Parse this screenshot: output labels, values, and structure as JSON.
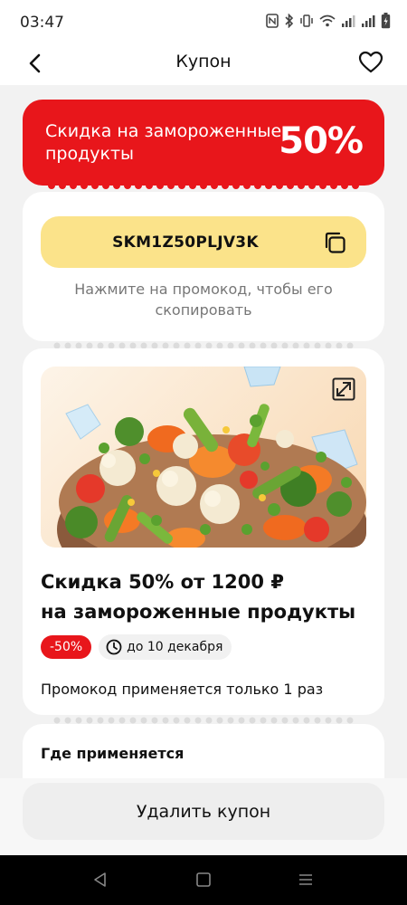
{
  "status_bar": {
    "time": "03:47",
    "icons": [
      "nfc-icon",
      "bluetooth-icon",
      "vibrate-icon",
      "wifi-icon",
      "signal-icon",
      "signal-icon",
      "battery-charging-icon"
    ]
  },
  "header": {
    "title": "Купон",
    "back_icon": "chevron-left-icon",
    "favorite_icon": "heart-outline-icon"
  },
  "banner": {
    "text": "Скидка на замороженные продукты",
    "percent": "50%",
    "color": "#e8161b"
  },
  "promo": {
    "code": "SKM1Z50PLJV3K",
    "copy_icon": "copy-icon",
    "hint": "Нажмите на промокод, чтобы его скопировать",
    "code_bg": "#fbe38a"
  },
  "offer": {
    "image_alt_icon": "expand-icon",
    "title_line1": "Скидка 50% от 1200 ₽",
    "title_line2": "на замороженные продукты",
    "discount_badge": "-50%",
    "date_badge": "до 10 декабря",
    "note": "Промокод применяется только 1 раз"
  },
  "where": {
    "title": "Где применяется"
  },
  "actions": {
    "delete_label": "Удалить купон"
  },
  "nav": {
    "icons": [
      "back-triangle-icon",
      "home-square-icon",
      "menu-lines-icon"
    ]
  }
}
